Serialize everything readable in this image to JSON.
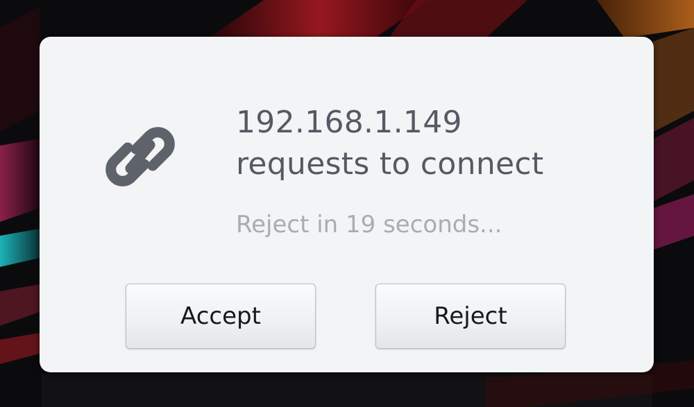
{
  "dialog": {
    "icon": "link-icon",
    "title_line1": "192.168.1.149",
    "title_line2": "requests to connect",
    "countdown": "Reject in 19 seconds...",
    "accept_label": "Accept",
    "reject_label": "Reject"
  },
  "colors": {
    "dialog_background": "#f3f4f6",
    "title_text": "#545a63",
    "countdown_text": "#a8acb3",
    "icon": "#5e636b"
  }
}
